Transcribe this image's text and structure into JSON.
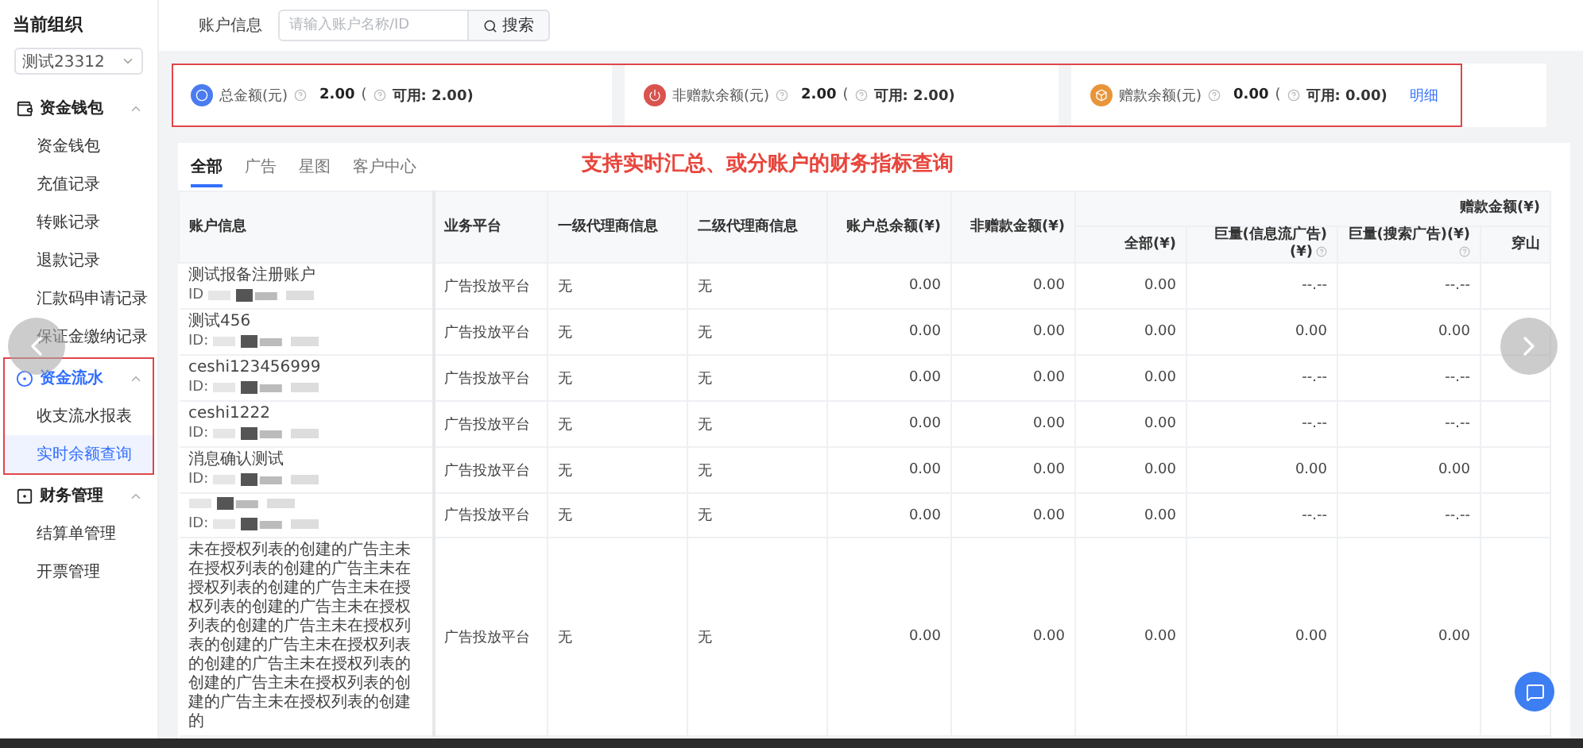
{
  "sidebar": {
    "title": "当前组织",
    "org_select": {
      "value": "测试23312"
    },
    "groups": [
      {
        "label": "资金钱包",
        "expanded": true,
        "selected": false,
        "highlighted": false,
        "items": [
          {
            "label": "资金钱包",
            "selected": false
          },
          {
            "label": "充值记录",
            "selected": false
          },
          {
            "label": "转账记录",
            "selected": false
          },
          {
            "label": "退款记录",
            "selected": false
          },
          {
            "label": "汇款码申请记录",
            "selected": false
          },
          {
            "label": "保证金缴纳记录",
            "selected": false
          }
        ]
      },
      {
        "label": "资金流水",
        "expanded": true,
        "selected": true,
        "highlighted": true,
        "items": [
          {
            "label": "收支流水报表",
            "selected": false
          },
          {
            "label": "实时余额查询",
            "selected": true
          }
        ]
      },
      {
        "label": "财务管理",
        "expanded": true,
        "selected": false,
        "highlighted": false,
        "items": [
          {
            "label": "结算单管理",
            "selected": false
          },
          {
            "label": "开票管理",
            "selected": false
          }
        ]
      }
    ]
  },
  "search_bar": {
    "label": "账户信息",
    "placeholder": "请输入账户名称/ID",
    "button": "搜索"
  },
  "summary": {
    "highlighted": true,
    "cards": [
      {
        "label": "总金额(元)",
        "amount": "2.00",
        "paren": "(",
        "available": "可用: 2.00)",
        "color": "#4a7cf0"
      },
      {
        "label": "非赠款余额(元)",
        "amount": "2.00",
        "paren": "(",
        "available": "可用: 2.00)",
        "color": "#d9534f"
      },
      {
        "label": "赠款余额(元)",
        "amount": "0.00",
        "paren": "(",
        "available": "可用: 0.00)",
        "color": "#e8953a",
        "link": "明细"
      }
    ]
  },
  "annotation": "支持实时汇总、或分账户的财务指标查询",
  "tabs": [
    {
      "label": "全部",
      "selected": true
    },
    {
      "label": "广告",
      "selected": false
    },
    {
      "label": "星图",
      "selected": false
    },
    {
      "label": "客户中心",
      "selected": false
    }
  ],
  "table": {
    "columns": [
      {
        "label": "账户信息"
      },
      {
        "label": "业务平台"
      },
      {
        "label": "一级代理商信息"
      },
      {
        "label": "二级代理商信息"
      },
      {
        "label": "账户总余额(¥)"
      },
      {
        "label": "非赠款金额(¥)"
      },
      {
        "label": "赠款金额(¥)",
        "colspan": 4,
        "children": [
          {
            "label": "全部(¥)",
            "help": false
          },
          {
            "label": "巨量(信息流广告)(¥)",
            "help": true
          },
          {
            "label": "巨量(搜索广告)(¥)",
            "help": true
          },
          {
            "label": "穿山",
            "help": false
          }
        ]
      }
    ],
    "rows": [
      {
        "cells": [
          {
            "name": "测试报备注册账户",
            "id_label": "ID"
          },
          "广告投放平台",
          "无",
          "无",
          "0.00",
          "0.00",
          "0.00",
          "--.--",
          "--.--",
          ""
        ]
      },
      {
        "cells": [
          {
            "name": "测试456",
            "id_label": "ID:"
          },
          "广告投放平台",
          "无",
          "无",
          "0.00",
          "0.00",
          "0.00",
          "0.00",
          "0.00",
          ""
        ]
      },
      {
        "cells": [
          {
            "name": "ceshi123456999",
            "id_label": "ID:"
          },
          "广告投放平台",
          "无",
          "无",
          "0.00",
          "0.00",
          "0.00",
          "--.--",
          "--.--",
          ""
        ]
      },
      {
        "cells": [
          {
            "name": "ceshi1222",
            "id_label": "ID:"
          },
          "广告投放平台",
          "无",
          "无",
          "0.00",
          "0.00",
          "0.00",
          "--.--",
          "--.--",
          ""
        ]
      },
      {
        "cells": [
          {
            "name": "消息确认测试",
            "id_label": "ID:"
          },
          "广告投放平台",
          "无",
          "无",
          "0.00",
          "0.00",
          "0.00",
          "0.00",
          "0.00",
          ""
        ]
      },
      {
        "cells": [
          {
            "id_label": "ID:"
          },
          "广告投放平台",
          "无",
          "无",
          "0.00",
          "0.00",
          "0.00",
          "--.--",
          "--.--",
          ""
        ]
      },
      {
        "cells": [
          {
            "name": "未在授权列表的创建的广告主未在授权列表的创建的广告主未在授权列表的创建的广告主未在授权列表的创建的广告主未在授权列表的创建的广告主未在授权列表的创建的广告主未在授权列表的创建的广告主未在授权列表的创建的广告主未在授权列表的创建的广告主未在授权列表的创建的"
          },
          "广告投放平台",
          "无",
          "无",
          "0.00",
          "0.00",
          "0.00",
          "0.00",
          "0.00",
          ""
        ]
      }
    ]
  }
}
